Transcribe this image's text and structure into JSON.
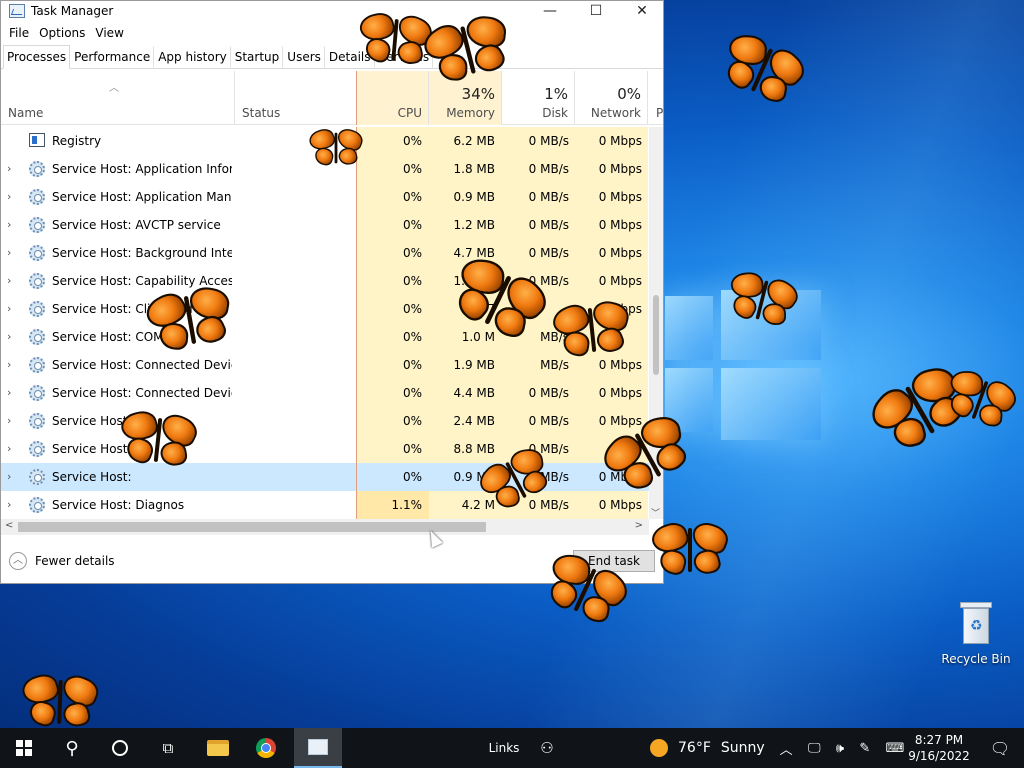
{
  "window": {
    "title": "Task Manager",
    "menu": [
      "File",
      "Options",
      "View"
    ],
    "tabs": [
      "Processes",
      "Performance",
      "App history",
      "Startup",
      "Users",
      "Details",
      "Services"
    ],
    "active_tab": "Processes"
  },
  "columns": {
    "name": "Name",
    "status": "Status",
    "cpu": {
      "pct": "",
      "label": "CPU"
    },
    "memory": {
      "pct": "34%",
      "label": "Memory"
    },
    "disk": {
      "pct": "1%",
      "label": "Disk"
    },
    "network": {
      "pct": "0%",
      "label": "Network"
    },
    "more": "P"
  },
  "processes": [
    {
      "name": "Registry",
      "cpu": "0%",
      "mem": "6.2 MB",
      "disk": "0 MB/s",
      "net": "0 Mbps",
      "expandable": false,
      "icon": "registry-icon"
    },
    {
      "name": "Service Host: Application Infor...",
      "cpu": "0%",
      "mem": "1.8 MB",
      "disk": "0 MB/s",
      "net": "0 Mbps",
      "expandable": true,
      "icon": "gear-icon"
    },
    {
      "name": "Service Host: Application Mana...",
      "cpu": "0%",
      "mem": "0.9 MB",
      "disk": "0 MB/s",
      "net": "0 Mbps",
      "expandable": true,
      "icon": "gear-icon"
    },
    {
      "name": "Service Host: AVCTP service",
      "cpu": "0%",
      "mem": "1.2 MB",
      "disk": "0 MB/s",
      "net": "0 Mbps",
      "expandable": true,
      "icon": "gear-icon"
    },
    {
      "name": "Service Host: Background Intelli...",
      "cpu": "0%",
      "mem": "4.7 MB",
      "disk": "0 MB/s",
      "net": "0 Mbps",
      "expandable": true,
      "icon": "gear-icon"
    },
    {
      "name": "Service Host: Capability Access ...",
      "cpu": "0%",
      "mem": "1.3 MB",
      "disk": "0 MB/s",
      "net": "0 Mbps",
      "expandable": true,
      "icon": "gear-icon"
    },
    {
      "name": "Service Host: Clipboard",
      "cpu": "0%",
      "mem": "1.7",
      "disk": "",
      "net": "0 Mbps",
      "expandable": true,
      "icon": "gear-icon"
    },
    {
      "name": "Service Host: COM",
      "cpu": "0%",
      "mem": "1.0 M",
      "disk": "MB/s",
      "net": "",
      "expandable": true,
      "icon": "gear-icon"
    },
    {
      "name": "Service Host: Connected Device...",
      "cpu": "0%",
      "mem": "1.9 MB",
      "disk": "MB/s",
      "net": "0 Mbps",
      "expandable": true,
      "icon": "gear-icon"
    },
    {
      "name": "Service Host: Connected Device...",
      "cpu": "0%",
      "mem": "4.4 MB",
      "disk": "0 MB/s",
      "net": "0 Mbps",
      "expandable": true,
      "icon": "gear-icon"
    },
    {
      "name": "Service Host: Cry",
      "cpu": "0%",
      "mem": "2.4 MB",
      "disk": "0 MB/s",
      "net": "0 Mbps",
      "expandable": true,
      "icon": "gear-icon"
    },
    {
      "name": "Service Host:",
      "cpu": "0%",
      "mem": "8.8 MB",
      "disk": "0 MB/s",
      "net": "0",
      "expandable": true,
      "icon": "gear-icon"
    },
    {
      "name": "Service Host:",
      "cpu": "0%",
      "mem": "0.9 MB",
      "disk": "MB/s",
      "net": "0 Mbps",
      "expandable": true,
      "icon": "gear-icon",
      "selected": true
    },
    {
      "name": "Service Host: Diagnos",
      "cpu": "1.1%",
      "mem": "4.2 M",
      "disk": "0 MB/s",
      "net": "0 Mbps",
      "expandable": true,
      "icon": "gear-icon"
    }
  ],
  "footer": {
    "fewer_details": "Fewer details",
    "end_task": "End task"
  },
  "desktop": {
    "recycle_bin": "Recycle Bin"
  },
  "taskbar": {
    "links": "Links",
    "weather": {
      "temp": "76°F",
      "condition": "Sunny"
    },
    "time": "8:27 PM",
    "date": "9/16/2022"
  }
}
